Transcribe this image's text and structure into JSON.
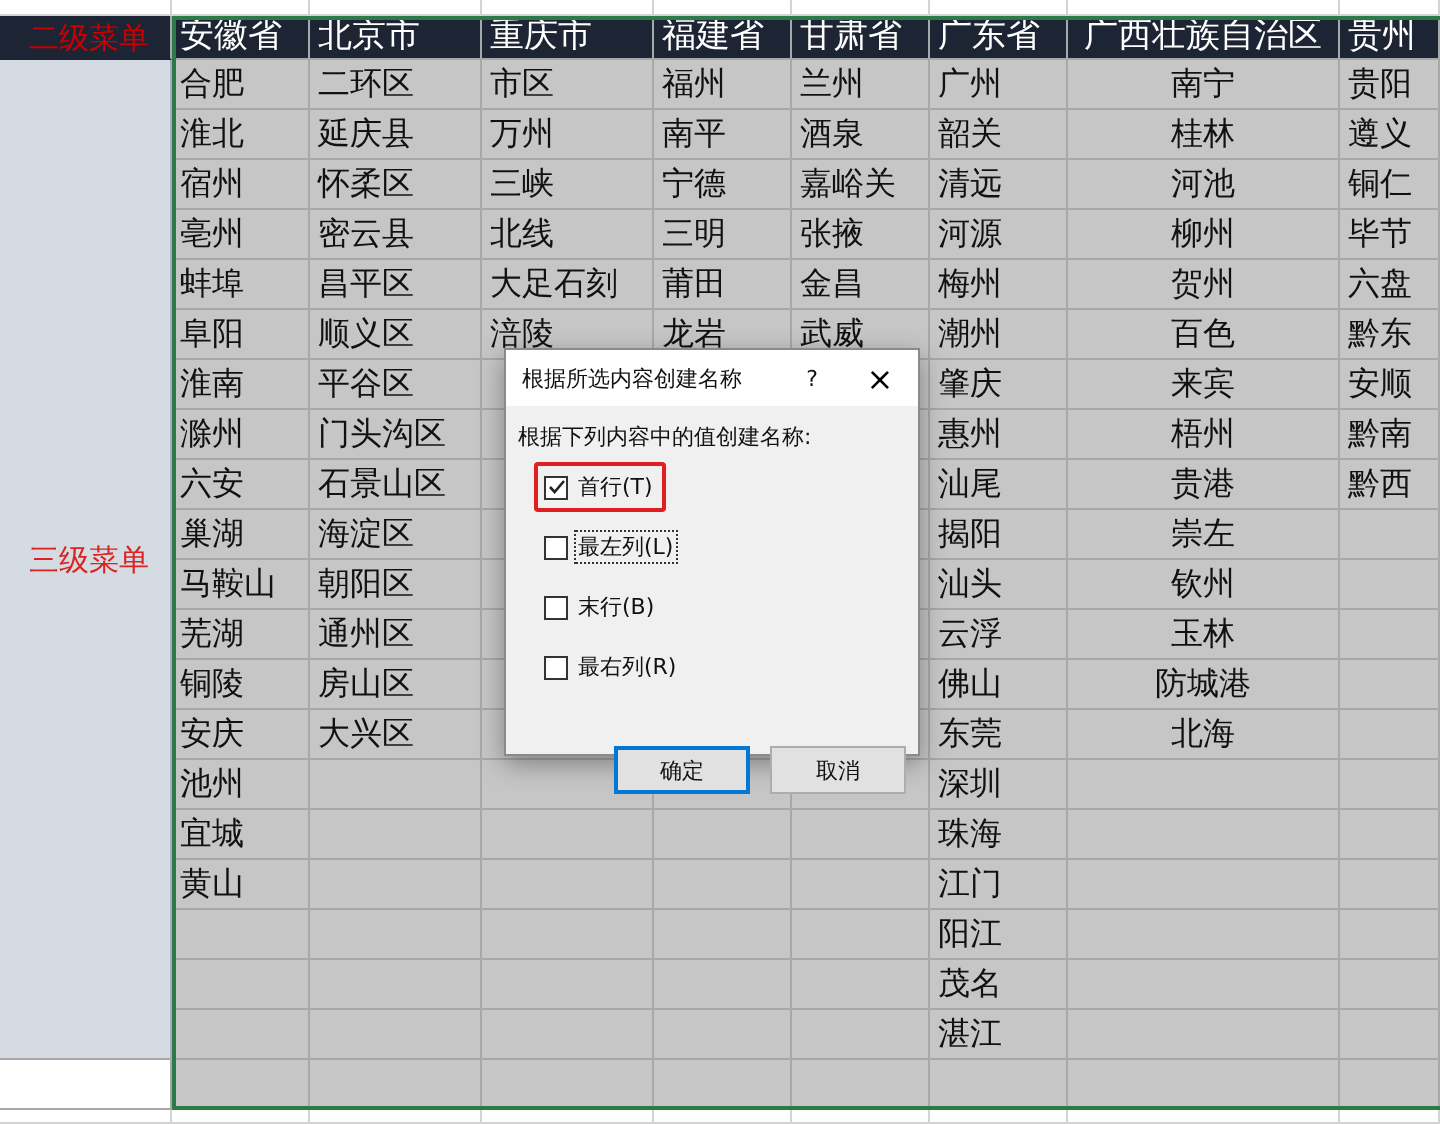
{
  "row_labels": [
    {
      "kind": "header",
      "text": "二级菜单"
    },
    {
      "kind": "body",
      "text": "三级菜单"
    }
  ],
  "table": {
    "columns": [
      {
        "header": "安徽省",
        "kind": "plain",
        "cells": [
          "合肥",
          "淮北",
          "宿州",
          "亳州",
          "蚌埠",
          "阜阳",
          "淮南",
          "滁州",
          "六安",
          "巢湖",
          "马鞍山",
          "芜湖",
          "铜陵",
          "安庆",
          "池州",
          "宜城",
          "黄山"
        ]
      },
      {
        "header": "北京市",
        "kind": "plain",
        "cells": [
          "二环区",
          "延庆县",
          "怀柔区",
          "密云县",
          "昌平区",
          "顺义区",
          "平谷区",
          "门头沟区",
          "石景山区",
          "海淀区",
          "朝阳区",
          "通州区",
          "房山区",
          "大兴区"
        ]
      },
      {
        "header": "重庆市",
        "kind": "plain",
        "cells": [
          "市区",
          "万州",
          "三峡",
          "北线",
          "大足石刻",
          "涪陵"
        ]
      },
      {
        "header": "福建省",
        "kind": "plain",
        "cells": [
          "福州",
          "南平",
          "宁德",
          "三明",
          "莆田",
          "龙岩"
        ]
      },
      {
        "header": "甘肃省",
        "kind": "plain",
        "cells": [
          "兰州",
          "酒泉",
          "嘉峪关",
          "张掖",
          "金昌",
          "武威"
        ]
      },
      {
        "header": "广东省",
        "kind": "plain",
        "cells": [
          "广州",
          "韶关",
          "清远",
          "河源",
          "梅州",
          "潮州",
          "肇庆",
          "惠州",
          "汕尾",
          "揭阳",
          "汕头",
          "云浮",
          "佛山",
          "东莞",
          "深圳",
          "珠海",
          "江门",
          "阳江",
          "茂名",
          "湛江"
        ]
      },
      {
        "header": "广西壮族自治区",
        "kind": "centered",
        "cells": [
          "南宁",
          "桂林",
          "河池",
          "柳州",
          "贺州",
          "百色",
          "来宾",
          "梧州",
          "贵港",
          "崇左",
          "钦州",
          "玉林",
          "防城港",
          "北海"
        ]
      },
      {
        "header": "贵州",
        "kind": "plain",
        "cells": [
          "贵阳",
          "遵义",
          "铜仁",
          "毕节",
          "六盘",
          "黔东",
          "安顺",
          "黔南",
          "黔西"
        ]
      }
    ]
  },
  "dialog": {
    "title": "根据所选内容创建名称",
    "help": "?",
    "close": "×",
    "prompt": "根据下列内容中的值创建名称:",
    "options": [
      {
        "label": "首行(T)",
        "checked": true,
        "highlighted": true,
        "focused": false
      },
      {
        "label": "最左列(L)",
        "checked": false,
        "highlighted": false,
        "focused": true
      },
      {
        "label": "末行(B)",
        "checked": false,
        "highlighted": false,
        "focused": false
      },
      {
        "label": "最右列(R)",
        "checked": false,
        "highlighted": false,
        "focused": false
      }
    ],
    "buttons": [
      {
        "label": "确定",
        "default": true
      },
      {
        "label": "取消",
        "default": false
      }
    ]
  }
}
